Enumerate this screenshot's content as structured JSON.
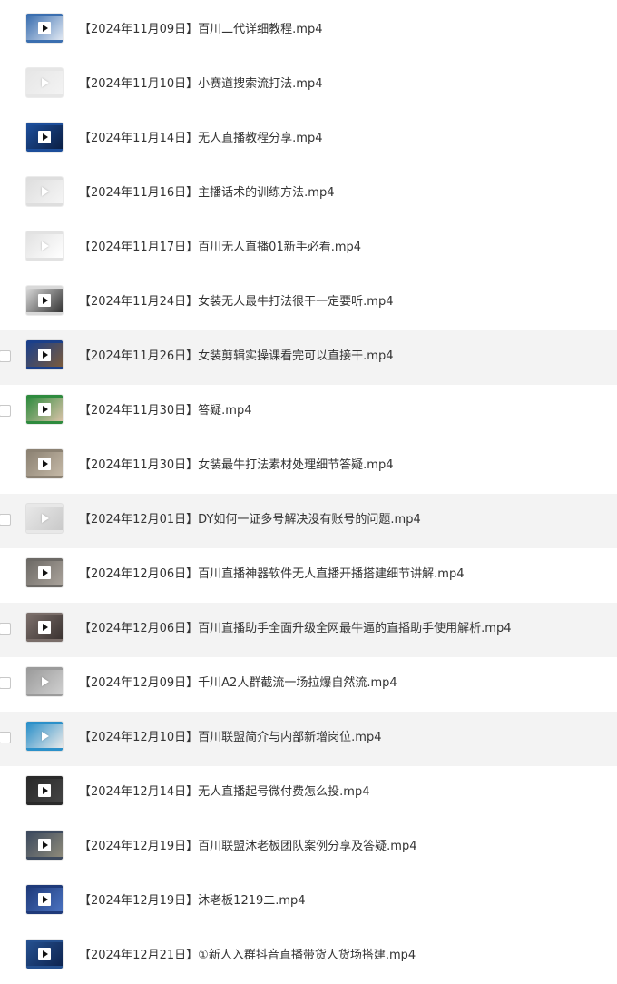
{
  "files": [
    {
      "name": "【2024年11月09日】百川二代详细教程.mp4",
      "thumb": {
        "bg": "#3b6fb0",
        "accent": "#dfe7f2",
        "dark": true
      },
      "checkbox": false,
      "alt": false
    },
    {
      "name": "【2024年11月10日】小赛道搜索流打法.mp4",
      "thumb": {
        "bg": "#e6e6e6",
        "accent": "#f3f3f3",
        "dark": false
      },
      "checkbox": false,
      "alt": false
    },
    {
      "name": "【2024年11月14日】无人直播教程分享.mp4",
      "thumb": {
        "bg": "#1d4e9a",
        "accent": "#0b1f44",
        "dark": true
      },
      "checkbox": false,
      "alt": false
    },
    {
      "name": "【2024年11月16日】主播话术的训练方法.mp4",
      "thumb": {
        "bg": "#dedede",
        "accent": "#f5f5f5",
        "dark": false
      },
      "checkbox": false,
      "alt": false
    },
    {
      "name": "【2024年11月17日】百川无人直播01新手必看.mp4",
      "thumb": {
        "bg": "#e2e2e2",
        "accent": "#ffffff",
        "dark": false
      },
      "checkbox": false,
      "alt": false
    },
    {
      "name": "【2024年11月24日】女装无人最牛打法很干一定要听.mp4",
      "thumb": {
        "bg": "#d9d9d9",
        "accent": "#333333",
        "dark": true
      },
      "checkbox": false,
      "alt": false
    },
    {
      "name": "【2024年11月26日】女装剪辑实操课看完可以直接干.mp4",
      "thumb": {
        "bg": "#1a3f8a",
        "accent": "#7a5a3c",
        "dark": true
      },
      "checkbox": true,
      "alt": true
    },
    {
      "name": "【2024年11月30日】答疑.mp4",
      "thumb": {
        "bg": "#2e8b3e",
        "accent": "#d9c2a8",
        "dark": true
      },
      "checkbox": true,
      "alt": false
    },
    {
      "name": "【2024年11月30日】女装最牛打法素材处理细节答疑.mp4",
      "thumb": {
        "bg": "#8c8273",
        "accent": "#c4b8a6",
        "dark": true
      },
      "checkbox": false,
      "alt": false
    },
    {
      "name": "【2024年12月01日】DY如何一证多号解决没有账号的问题.mp4",
      "thumb": {
        "bg": "#e8e8e8",
        "accent": "#c9c9c9",
        "dark": false
      },
      "checkbox": true,
      "alt": true
    },
    {
      "name": "【2024年12月06日】百川直播神器软件无人直播开播搭建细节讲解.mp4",
      "thumb": {
        "bg": "#6d6a66",
        "accent": "#a9a29a",
        "dark": true
      },
      "checkbox": false,
      "alt": false
    },
    {
      "name": "【2024年12月06日】百川直播助手全面升级全网最牛逼的直播助手使用解析.mp4",
      "thumb": {
        "bg": "#7a6e6a",
        "accent": "#3b3331",
        "dark": true
      },
      "checkbox": true,
      "alt": true
    },
    {
      "name": "【2024年12月09日】千川A2人群截流一场拉爆自然流.mp4",
      "thumb": {
        "bg": "#9b9b9b",
        "accent": "#cfcfcf",
        "dark": false
      },
      "checkbox": true,
      "alt": false
    },
    {
      "name": "【2024年12月10日】百川联盟简介与内部新增岗位.mp4",
      "thumb": {
        "bg": "#2b90c9",
        "accent": "#e9e9e9",
        "dark": false
      },
      "checkbox": true,
      "alt": true
    },
    {
      "name": "【2024年12月14日】无人直播起号微付费怎么投.mp4",
      "thumb": {
        "bg": "#2a2a2a",
        "accent": "#444444",
        "dark": true
      },
      "checkbox": false,
      "alt": false
    },
    {
      "name": "【2024年12月19日】百川联盟沐老板团队案例分享及答疑.mp4",
      "thumb": {
        "bg": "#3d4a5e",
        "accent": "#8d8a7a",
        "dark": true
      },
      "checkbox": false,
      "alt": false
    },
    {
      "name": "【2024年12月19日】沐老板1219二.mp4",
      "thumb": {
        "bg": "#1f3a7a",
        "accent": "#4a72c0",
        "dark": true
      },
      "checkbox": false,
      "alt": false
    },
    {
      "name": "【2024年12月21日】①新人入群抖音直播带货人货场搭建.mp4",
      "thumb": {
        "bg": "#25508f",
        "accent": "#0e2450",
        "dark": true
      },
      "checkbox": false,
      "alt": false
    }
  ]
}
